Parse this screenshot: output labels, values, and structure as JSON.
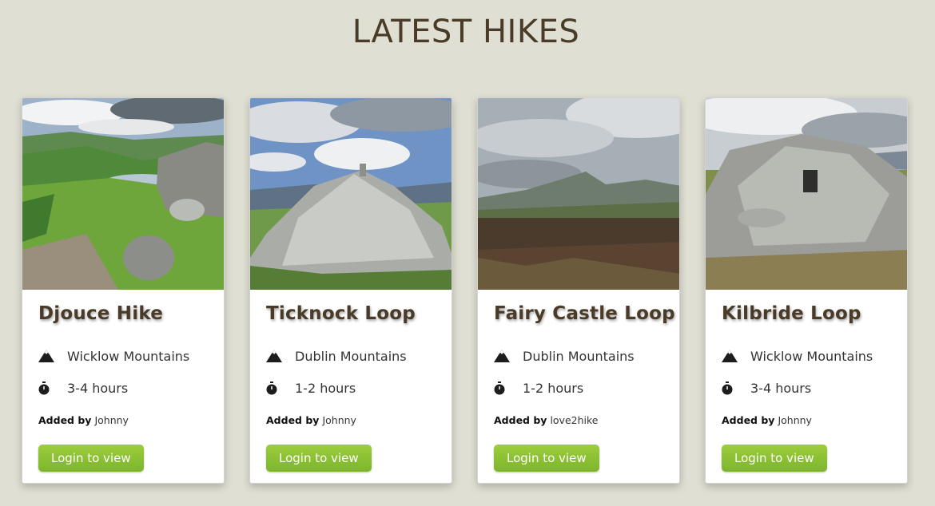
{
  "page": {
    "title": "LATEST HIKES"
  },
  "hikes": [
    {
      "name": "Djouce Hike",
      "location": "Wicklow Mountains",
      "duration": "3-4 hours",
      "added_by_label": "Added by",
      "author": "Johnny",
      "button_label": "Login to view",
      "image": "lake-valley-photo"
    },
    {
      "name": "Ticknock Loop",
      "location": "Dublin Mountains",
      "duration": "1-2 hours",
      "added_by_label": "Added by",
      "author": "Johnny",
      "button_label": "Login to view",
      "image": "stone-cairn-photo"
    },
    {
      "name": "Fairy Castle Loop",
      "location": "Dublin Mountains",
      "duration": "1-2 hours",
      "added_by_label": "Added by",
      "author": "love2hike",
      "button_label": "Login to view",
      "image": "moorland-view-photo"
    },
    {
      "name": "Kilbride Loop",
      "location": "Wicklow Mountains",
      "duration": "3-4 hours",
      "added_by_label": "Added by",
      "author": "Johnny",
      "button_label": "Login to view",
      "image": "rock-cairn-photo"
    }
  ],
  "icons": {
    "location": "mountain-icon",
    "duration": "stopwatch-icon"
  },
  "colors": {
    "background": "#dfdfd3",
    "title": "#4a3a28",
    "button": "#8cc135"
  }
}
